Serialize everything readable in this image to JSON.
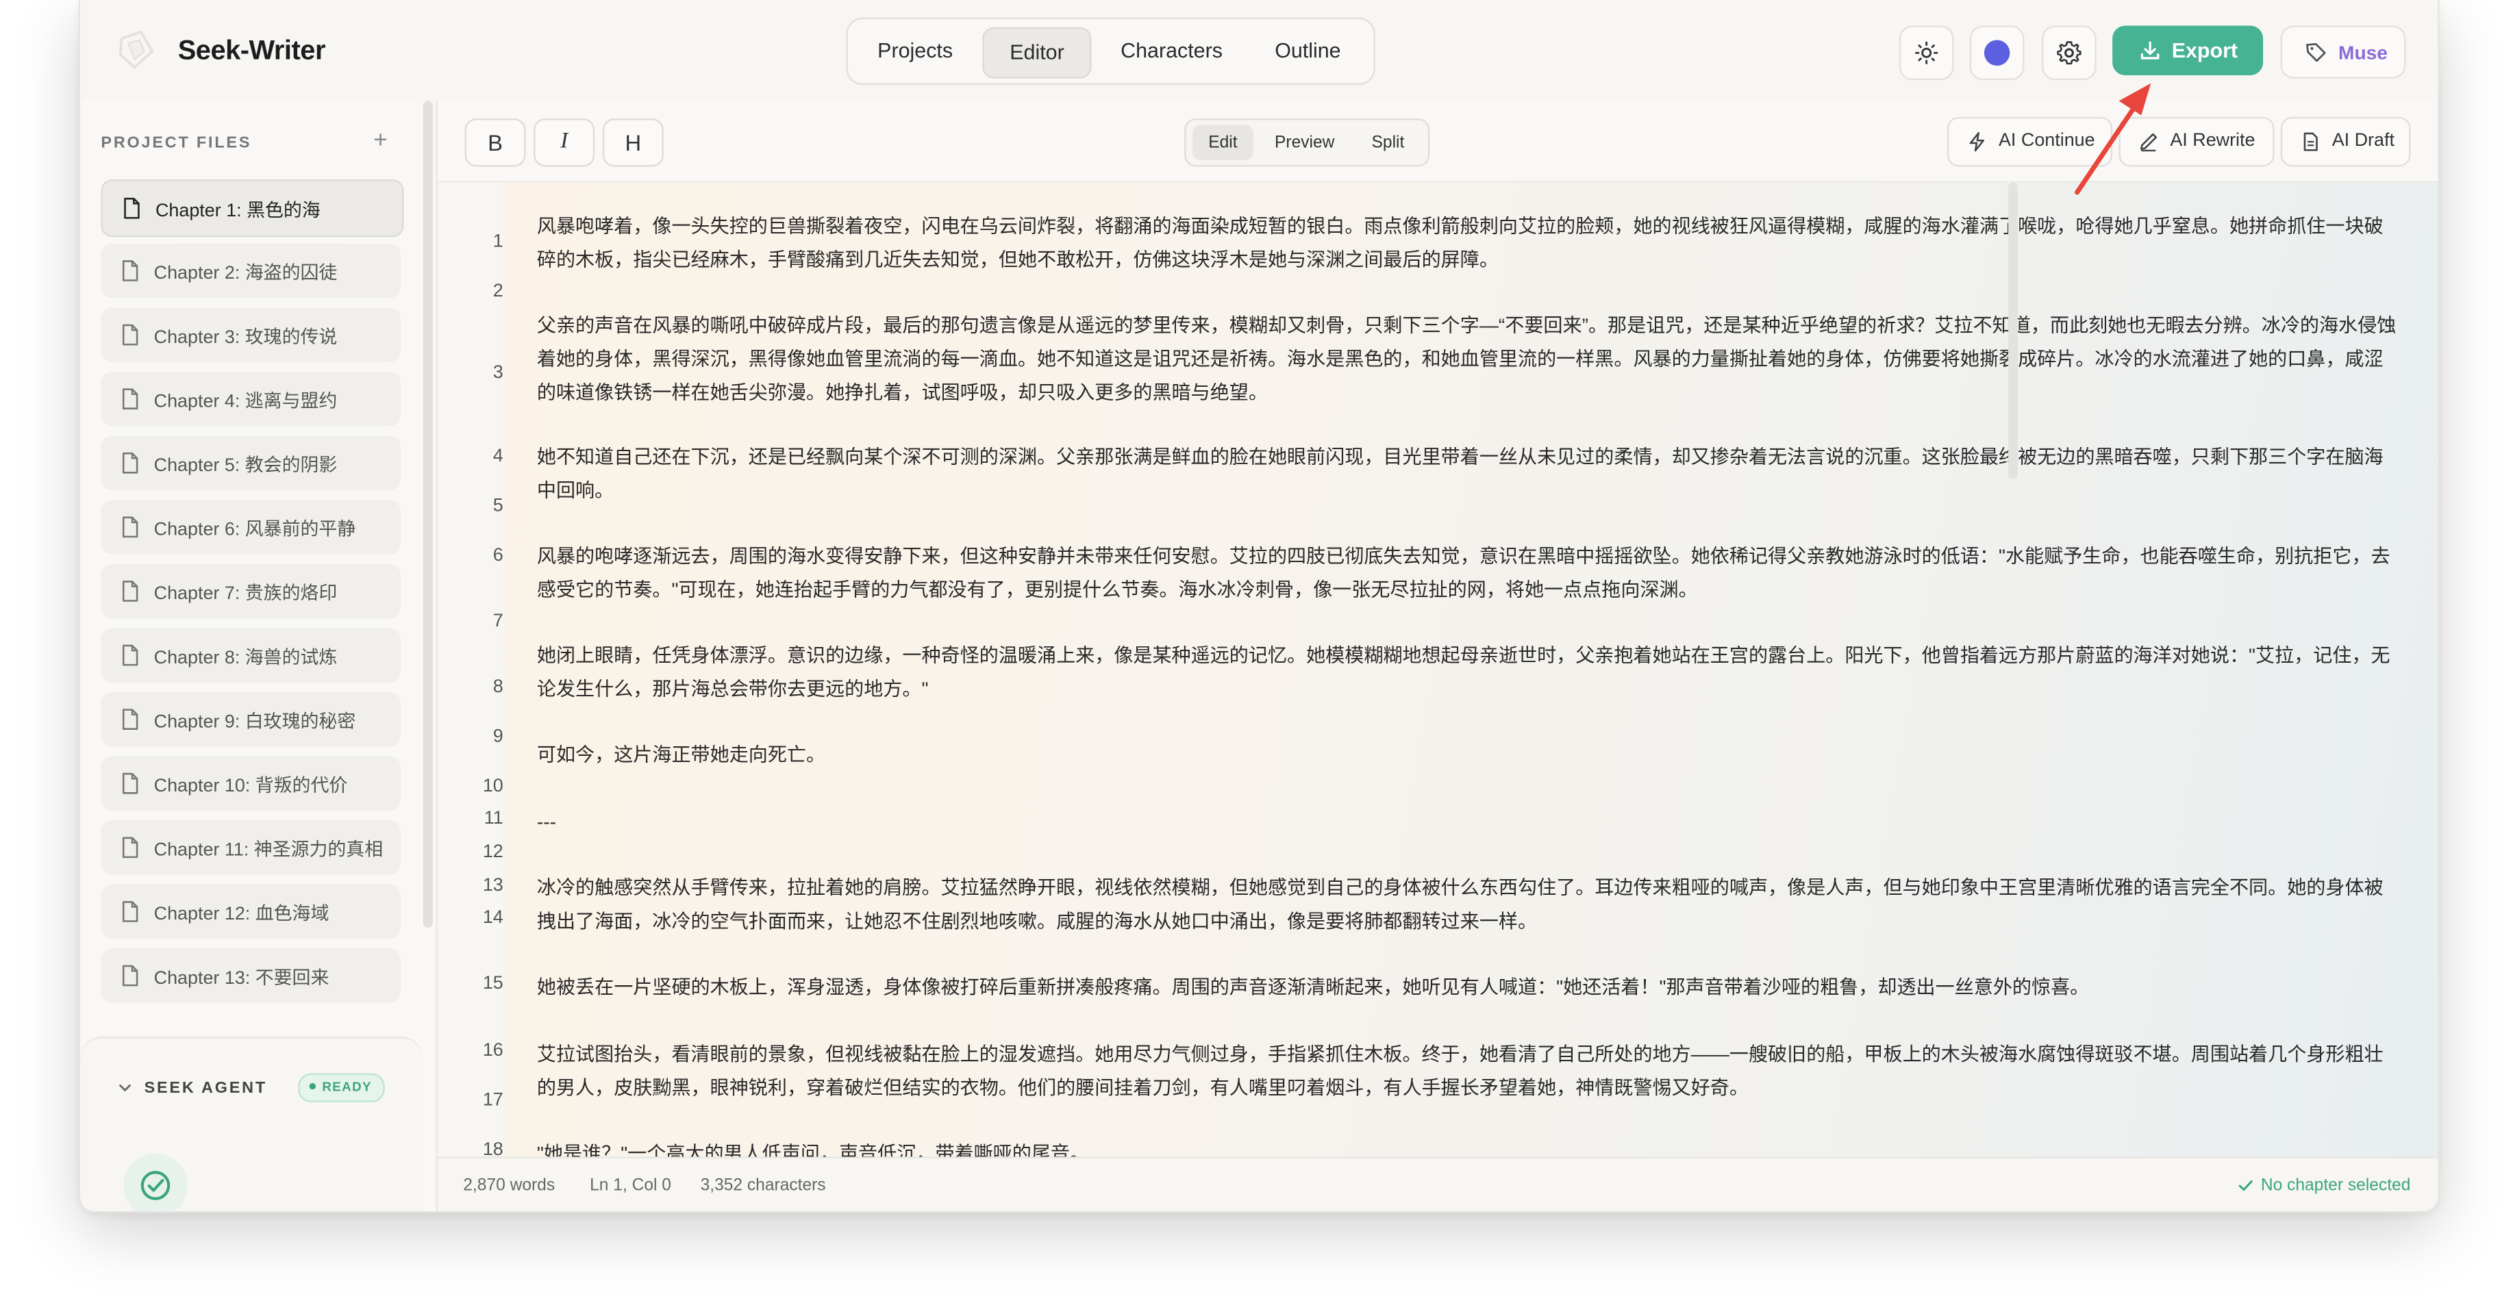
{
  "app": {
    "name": "Seek-Writer"
  },
  "nav": {
    "tabs": [
      "Projects",
      "Editor",
      "Characters",
      "Outline"
    ],
    "active": "Editor"
  },
  "header": {
    "export_label": "Export",
    "muse_label": "Muse"
  },
  "colors": {
    "accent": "#46b392",
    "theme_dot": "#5b5fe0",
    "muse": "#8a6bd8",
    "ready": "#3aa57c"
  },
  "sidebar": {
    "heading": "PROJECT FILES",
    "chapters": [
      "Chapter 1: 黑色的海",
      "Chapter 2: 海盗的囚徒",
      "Chapter 3: 玫瑰的传说",
      "Chapter 4: 逃离与盟约",
      "Chapter 5: 教会的阴影",
      "Chapter 6: 风暴前的平静",
      "Chapter 7: 贵族的烙印",
      "Chapter 8: 海兽的试炼",
      "Chapter 9: 白玫瑰的秘密",
      "Chapter 10: 背叛的代价",
      "Chapter 11: 神圣源力的真相",
      "Chapter 12: 血色海域",
      "Chapter 13: 不要回来"
    ]
  },
  "agent": {
    "title": "SEEK AGENT",
    "status": "READY"
  },
  "toolbar": {
    "bold": "B",
    "italic": "I",
    "heading": "H",
    "modes": [
      "Edit",
      "Preview",
      "Split"
    ],
    "active_mode": "Edit",
    "ai_continue": "AI Continue",
    "ai_rewrite": "AI Rewrite",
    "ai_draft": "AI Draft"
  },
  "editor": {
    "line_numbers": [
      "1",
      "2",
      "3",
      "4",
      "5",
      "6",
      "7",
      "8",
      "9",
      "10",
      "11",
      "12",
      "13",
      "14",
      "15",
      "16",
      "17",
      "18"
    ],
    "paragraphs": [
      "风暴咆哮着，像一头失控的巨兽撕裂着夜空，闪电在乌云间炸裂，将翻涌的海面染成短暂的银白。雨点像利箭般刺向艾拉的脸颊，她的视线被狂风逼得模糊，咸腥的海水灌满了喉咙，呛得她几乎窒息。她拼命抓住一块破碎的木板，指尖已经麻木，手臂酸痛到几近失去知觉，但她不敢松开，仿佛这块浮木是她与深渊之间最后的屏障。",
      "父亲的声音在风暴的嘶吼中破碎成片段，最后的那句遗言像是从遥远的梦里传来，模糊却又刺骨，只剩下三个字—“不要回来”。那是诅咒，还是某种近乎绝望的祈求？艾拉不知道，而此刻她也无暇去分辨。冰冷的海水侵蚀着她的身体，黑得深沉，黑得像她血管里流淌的每一滴血。她不知道这是诅咒还是祈祷。海水是黑色的，和她血管里流的一样黑。风暴的力量撕扯着她的身体，仿佛要将她撕裂成碎片。冰冷的水流灌进了她的口鼻，咸涩的味道像铁锈一样在她舌尖弥漫。她挣扎着，试图呼吸，却只吸入更多的黑暗与绝望。",
      "她不知道自己还在下沉，还是已经飘向某个深不可测的深渊。父亲那张满是鲜血的脸在她眼前闪现，目光里带着一丝从未见过的柔情，却又掺杂着无法言说的沉重。这张脸最终被无边的黑暗吞噬，只剩下那三个字在脑海中回响。",
      "风暴的咆哮逐渐远去，周围的海水变得安静下来，但这种安静并未带来任何安慰。艾拉的四肢已彻底失去知觉，意识在黑暗中摇摇欲坠。她依稀记得父亲教她游泳时的低语：\"水能赋予生命，也能吞噬生命，别抗拒它，去感受它的节奏。\"可现在，她连抬起手臂的力气都没有了，更别提什么节奏。海水冰冷刺骨，像一张无尽拉扯的网，将她一点点拖向深渊。",
      "她闭上眼睛，任凭身体漂浮。意识的边缘，一种奇怪的温暖涌上来，像是某种遥远的记忆。她模模糊糊地想起母亲逝世时，父亲抱着她站在王宫的露台上。阳光下，他曾指着远方那片蔚蓝的海洋对她说：\"艾拉，记住，无论发生什么，那片海总会带你去更远的地方。\"",
      "可如今，这片海正带她走向死亡。",
      "---",
      "冰冷的触感突然从手臂传来，拉扯着她的肩膀。艾拉猛然睁开眼，视线依然模糊，但她感觉到自己的身体被什么东西勾住了。耳边传来粗哑的喊声，像是人声，但与她印象中王宫里清晰优雅的语言完全不同。她的身体被拽出了海面，冰冷的空气扑面而来，让她忍不住剧烈地咳嗽。咸腥的海水从她口中涌出，像是要将肺都翻转过来一样。",
      "她被丢在一片坚硬的木板上，浑身湿透，身体像被打碎后重新拼凑般疼痛。周围的声音逐渐清晰起来，她听见有人喊道：\"她还活着！\"那声音带着沙哑的粗鲁，却透出一丝意外的惊喜。",
      "艾拉试图抬头，看清眼前的景象，但视线被黏在脸上的湿发遮挡。她用尽力气侧过身，手指紧抓住木板。终于，她看清了自己所处的地方——一艘破旧的船，甲板上的木头被海水腐蚀得斑驳不堪。周围站着几个身形粗壮的男人，皮肤黝黑，眼神锐利，穿着破烂但结实的衣物。他们的腰间挂着刀剑，有人嘴里叼着烟斗，有人手握长矛望着她，神情既警惕又好奇。",
      "\"她是谁？\"一个高大的男人低声问，声音低沉，带着嘶哑的尾音。"
    ]
  },
  "status": {
    "words": "2,870 words",
    "position": "Ln 1, Col 0",
    "characters": "3,352 characters",
    "chapter_state": "No chapter selected"
  }
}
